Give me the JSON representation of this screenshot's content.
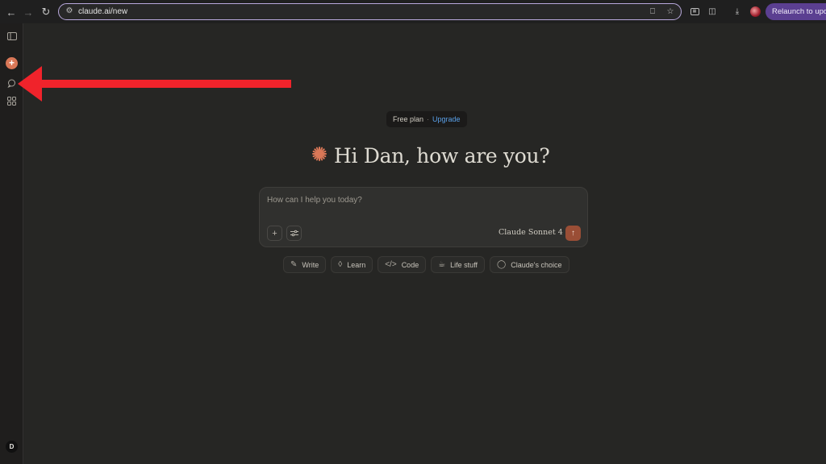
{
  "browser": {
    "url": "claude.ai/new",
    "relaunch_label": "Relaunch to update"
  },
  "sidebar": {
    "avatar_initial": "D"
  },
  "main": {
    "plan": {
      "label": "Free plan",
      "separator": "·",
      "upgrade": "Upgrade"
    },
    "greeting": "Hi Dan, how are you?",
    "composer": {
      "placeholder": "How can I help you today?",
      "model": "Claude Sonnet 4"
    },
    "chips": [
      {
        "label": "Write",
        "icon": "pencil-icon"
      },
      {
        "label": "Learn",
        "icon": "graduation-cap-icon"
      },
      {
        "label": "Code",
        "icon": "code-icon"
      },
      {
        "label": "Life stuff",
        "icon": "coffee-icon"
      },
      {
        "label": "Claude's choice",
        "icon": "lightbulb-icon"
      }
    ]
  },
  "colors": {
    "accent": "#d97757",
    "background": "#262624",
    "annotation_arrow": "#f0232b"
  }
}
